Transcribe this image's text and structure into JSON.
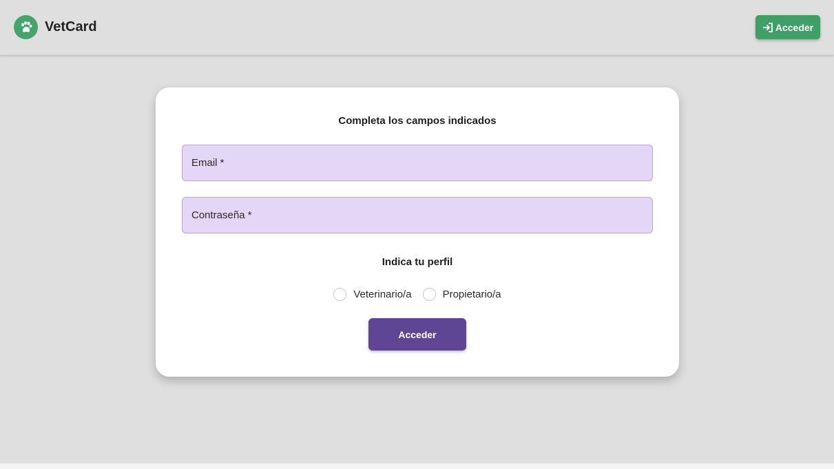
{
  "header": {
    "brand_name": "VetCard",
    "logo_icon": "paw-icon",
    "login_button_label": "Acceder",
    "login_icon": "login-arrow-icon"
  },
  "form": {
    "title": "Completa los campos indicados",
    "email_label": "Email *",
    "password_label": "Contraseña *",
    "profile_title": "Indica tu perfil",
    "profile_options": [
      {
        "label": "Veterinario/a",
        "selected": false
      },
      {
        "label": "Propietario/a",
        "selected": false
      }
    ],
    "submit_label": "Acceder"
  },
  "colors": {
    "brand_green": "#44a46b",
    "header_button_green": "#3fa067",
    "field_background": "#e4d6f7",
    "submit_purple": "#5e4694",
    "page_background": "#dfdfdf"
  }
}
